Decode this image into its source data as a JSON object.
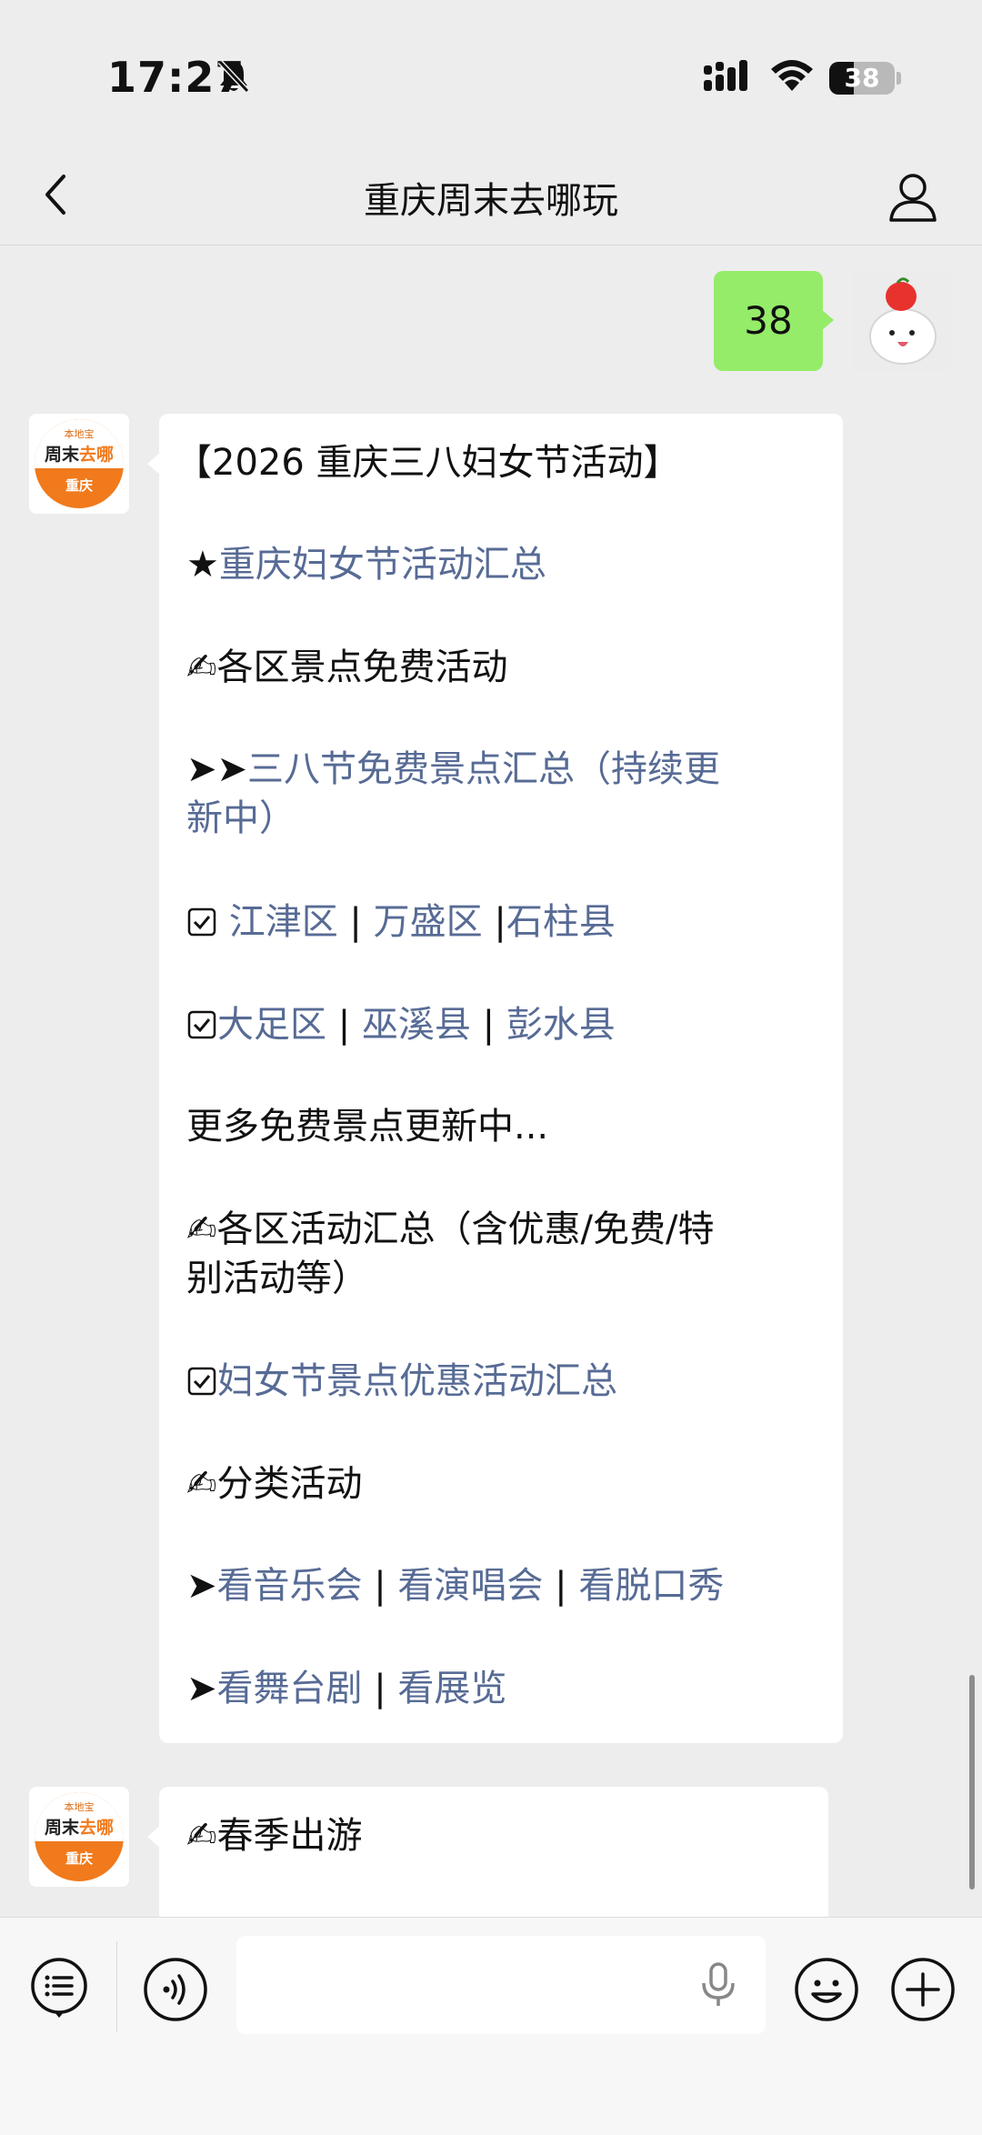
{
  "status_bar": {
    "time": "17:27",
    "battery_level": "38",
    "icons": [
      "bell-slash-icon",
      "signal-icon",
      "wifi-icon",
      "battery-icon"
    ]
  },
  "nav": {
    "title": "重庆周末去哪玩",
    "icons": [
      "chevron-left-icon",
      "person-icon"
    ]
  },
  "sent_message": {
    "text": "38",
    "bubble_color": "#95ec69"
  },
  "bot_avatar": {
    "small_text": "本地宝",
    "name_part1": "周末",
    "name_part2": "去哪",
    "city": "重庆",
    "accent_color": "#f07a1c"
  },
  "message1": {
    "heading": "【2026 重庆三八妇女节活动】",
    "item_summary": {
      "prefix": "★",
      "link": "重庆妇女节活动汇总"
    },
    "section_free": {
      "prefix": "✍",
      "text": "各区景点免费活动"
    },
    "free_summary": {
      "prefix": "➤➤",
      "link_line1": "三八节免费景点汇总（持续更",
      "link_line2": "新中）"
    },
    "districts_row1": [
      {
        "name": "江津区",
        "sep": " | "
      },
      {
        "name": "万盛区",
        "sep": " |"
      },
      {
        "name": "石柱县",
        "sep": ""
      }
    ],
    "districts_row2": [
      {
        "name": "大足区",
        "sep": " | "
      },
      {
        "name": "巫溪县",
        "sep": " | "
      },
      {
        "name": "彭水县",
        "sep": ""
      }
    ],
    "more_free": "更多免费景点更新中...",
    "section_districts": {
      "prefix": "✍",
      "text_line1": "各区活动汇总（含优惠/免费/特",
      "text_line2": "别活动等）"
    },
    "discount_summary": "妇女节景点优惠活动汇总",
    "section_category": {
      "prefix": "✍",
      "text": "分类活动"
    },
    "category_row1": [
      {
        "name": "看音乐会",
        "sep": " | "
      },
      {
        "name": "看演唱会",
        "sep": " | "
      },
      {
        "name": "看脱口秀",
        "sep": ""
      }
    ],
    "category_row2": [
      {
        "name": "看舞台剧",
        "sep": " | "
      },
      {
        "name": "看展览",
        "sep": ""
      }
    ],
    "arrow": "➤",
    "link_color": "#576b95"
  },
  "message2": {
    "prefix": "✍",
    "text": "春季出游"
  },
  "input_bar": {
    "icons": [
      "menu-list-icon",
      "voice-icon",
      "mic-icon",
      "emoji-icon",
      "plus-icon"
    ],
    "placeholder": ""
  }
}
